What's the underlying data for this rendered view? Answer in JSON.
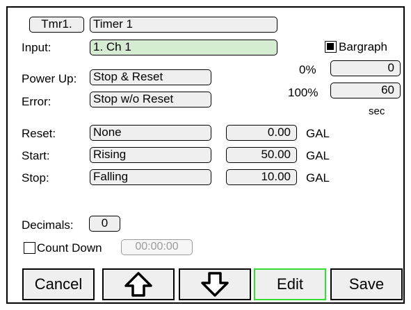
{
  "timer": {
    "id_button": "Tmr1.",
    "name": "Timer 1"
  },
  "input": {
    "label": "Input:",
    "value": "1. Ch 1"
  },
  "bargraph": {
    "label": "Bargraph",
    "checked": true
  },
  "scale": {
    "low_label": "0%",
    "low_value": "0",
    "high_label": "100%",
    "high_value": "60",
    "unit": "sec"
  },
  "power_up": {
    "label": "Power Up:",
    "value": "Stop & Reset"
  },
  "error": {
    "label": "Error:",
    "value": "Stop w/o Reset"
  },
  "rows": [
    {
      "label": "Reset:",
      "mode": "None",
      "value": "0.00",
      "unit": "GAL"
    },
    {
      "label": "Start:",
      "mode": "Rising",
      "value": "50.00",
      "unit": "GAL"
    },
    {
      "label": "Stop:",
      "mode": "Falling",
      "value": "10.00",
      "unit": "GAL"
    }
  ],
  "decimals": {
    "label": "Decimals:",
    "value": "0"
  },
  "count_down": {
    "label": "Count Down",
    "checked": false,
    "time": "00:00:00"
  },
  "buttons": {
    "cancel": "Cancel",
    "up_icon": "arrow-up-icon",
    "down_icon": "arrow-down-icon",
    "edit": "Edit",
    "save": "Save"
  },
  "colors": {
    "input_field": "#d6ecd2",
    "edit_border": "#33dd33",
    "field_bg": "#efefef",
    "disabled": "#9a9a9a"
  }
}
